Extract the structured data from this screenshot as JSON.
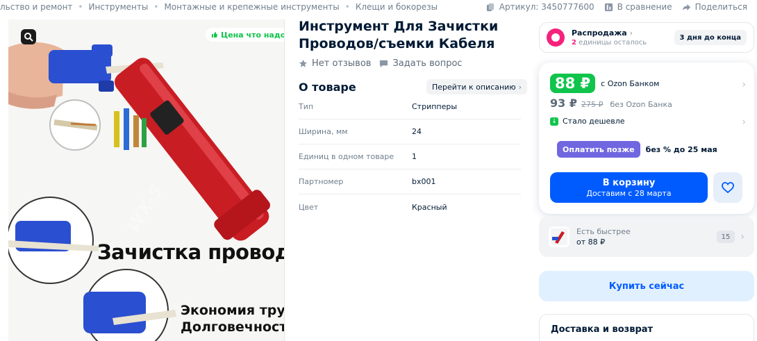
{
  "breadcrumbs": [
    "льство и ремонт",
    "Инструменты",
    "Монтажные и крепежные инструменты",
    "Клещи и бокорезы"
  ],
  "meta": {
    "article": "Артикул: 3450777600",
    "compare": "В сравнение",
    "share": "Поделиться"
  },
  "gallery": {
    "price_pill": "Цена что надо",
    "caption_main": "Зачистка проводов",
    "caption_line1": "Экономия труда",
    "caption_line2": "Долговечность",
    "tool_mark": "WX-5"
  },
  "product": {
    "title": "Инструмент Для Зачистки Проводов/съемки Кабеля",
    "reviews": "Нет отзывов",
    "ask": "Задать вопрос"
  },
  "about": {
    "heading": "О товаре",
    "to_description": "Перейти к описанию",
    "specs": [
      {
        "key": "Тип",
        "value": "Стрипперы"
      },
      {
        "key": "Ширина, мм",
        "value": "24"
      },
      {
        "key": "Единиц в одном товаре",
        "value": "1"
      },
      {
        "key": "Партномер",
        "value": "bx001"
      },
      {
        "key": "Цвет",
        "value": "Красный"
      }
    ]
  },
  "sale": {
    "title": "Распродажа",
    "units_count": "2",
    "units_text": " единицы осталось",
    "days": "3 дня до конца"
  },
  "price": {
    "ozon_price": "88 ₽",
    "ozon_label": "с Ozon Банком",
    "regular_price": "93 ₽",
    "old_price": "275 ₽",
    "regular_label": "без Ozon Банка",
    "cheaper": "Стало дешевле",
    "pay_later_button": "Оплатить позже",
    "pay_later_text": "без % до 25 мая",
    "cart_label": "В корзину",
    "cart_sub": "Доставим с 28 марта"
  },
  "faster": {
    "title": "Есть быстрее",
    "price": "от 88 ₽",
    "count": "15"
  },
  "buy_now": "Купить сейчас",
  "delivery": "Доставка и возврат",
  "colors": {
    "accent_blue": "#005bff",
    "green_price": "#10c44c",
    "sale_pink": "#f5217b",
    "pay_later_purple": "#7066e0"
  }
}
